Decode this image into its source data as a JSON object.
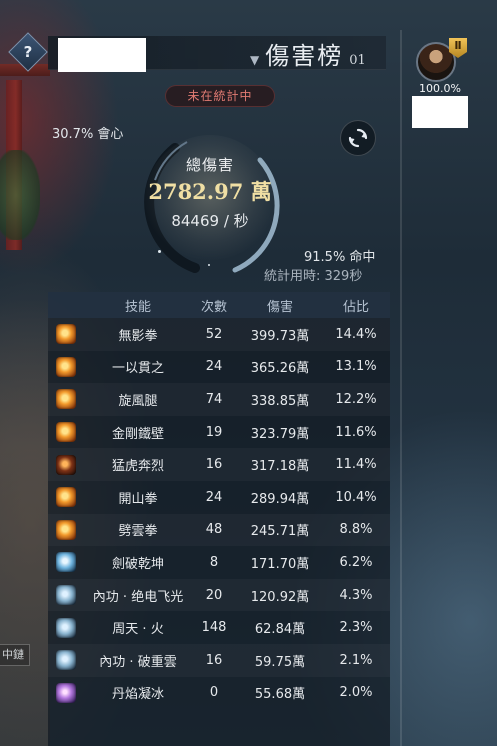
{
  "header": {
    "help_label": "?",
    "title": "傷害榜",
    "title_number": "01"
  },
  "status": {
    "pill": "未在統計中",
    "crit": "30.7% 會心",
    "total_label": "總傷害",
    "total_value": "2782.97 萬",
    "dps": "84469 / 秒",
    "hit": "91.5% 命中",
    "duration": "統計用時: 329秒"
  },
  "player": {
    "percent": "100.0%",
    "badge": "Ⅱ"
  },
  "table": {
    "headers": {
      "skill": "技能",
      "count": "次數",
      "damage": "傷害",
      "percent": "佔比"
    },
    "rows": [
      {
        "icon": "fist-fire-icon",
        "style": "fire",
        "skill": "無影拳",
        "count": "52",
        "damage": "399.73萬",
        "percent": "14.4%"
      },
      {
        "icon": "flame-strike-icon",
        "style": "fire",
        "skill": "一以貫之",
        "count": "24",
        "damage": "365.26萬",
        "percent": "13.1%"
      },
      {
        "icon": "whirl-kick-icon",
        "style": "fire",
        "skill": "旋風腿",
        "count": "74",
        "damage": "338.85萬",
        "percent": "12.2%"
      },
      {
        "icon": "iron-wall-icon",
        "style": "fire",
        "skill": "金剛鐵壁",
        "count": "19",
        "damage": "323.79萬",
        "percent": "11.6%"
      },
      {
        "icon": "tiger-icon",
        "style": "dark",
        "skill": "猛虎奔烈",
        "count": "16",
        "damage": "317.18萬",
        "percent": "11.4%"
      },
      {
        "icon": "mountain-fist-icon",
        "style": "fire",
        "skill": "開山拳",
        "count": "24",
        "damage": "289.94萬",
        "percent": "10.4%"
      },
      {
        "icon": "cloud-fist-icon",
        "style": "fire",
        "skill": "劈雲拳",
        "count": "48",
        "damage": "245.71萬",
        "percent": "8.8%"
      },
      {
        "icon": "sword-burst-icon",
        "style": "ice",
        "skill": "劍破乾坤",
        "count": "8",
        "damage": "171.70萬",
        "percent": "6.2%"
      },
      {
        "icon": "lightning-icon",
        "style": "wind",
        "skill": "內功 · 绝电飞光",
        "count": "20",
        "damage": "120.92萬",
        "percent": "4.3%"
      },
      {
        "icon": "orbit-fire-icon",
        "style": "wind",
        "skill": "周天 · 火",
        "count": "148",
        "damage": "62.84萬",
        "percent": "2.3%"
      },
      {
        "icon": "cloud-break-icon",
        "style": "wind",
        "skill": "內功 · 破重雲",
        "count": "16",
        "damage": "59.75萬",
        "percent": "2.1%"
      },
      {
        "icon": "ice-flame-icon",
        "style": "purple",
        "skill": "丹焰凝冰",
        "count": "0",
        "damage": "55.68萬",
        "percent": "2.0%"
      }
    ]
  },
  "scenery": {
    "side_tag": "中鏈"
  }
}
